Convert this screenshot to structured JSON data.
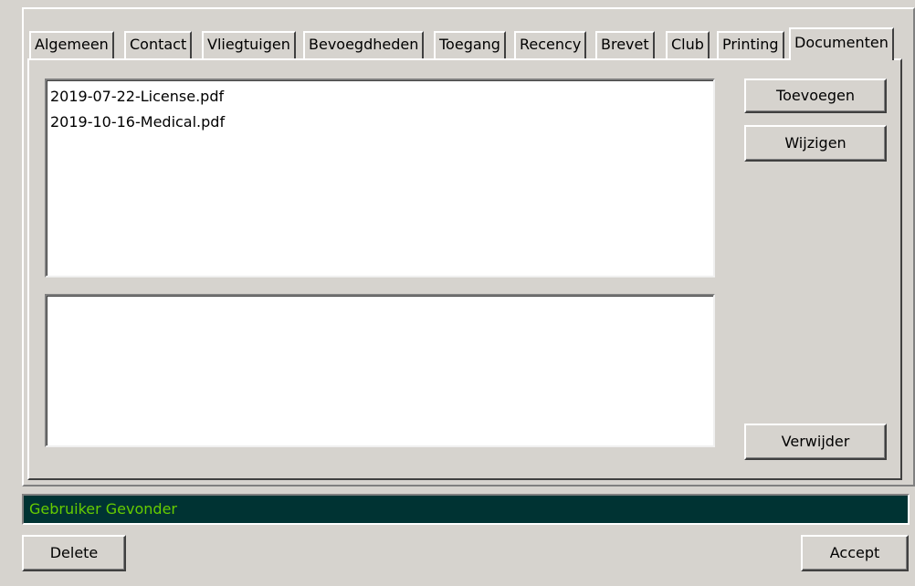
{
  "tabs": [
    {
      "label": "Algemeen",
      "active": false
    },
    {
      "label": "Contact",
      "active": false
    },
    {
      "label": "Vliegtuigen",
      "active": false
    },
    {
      "label": "Bevoegdheden",
      "active": false
    },
    {
      "label": "Toegang",
      "active": false
    },
    {
      "label": "Recency",
      "active": false
    },
    {
      "label": "Brevet",
      "active": false
    },
    {
      "label": "Club",
      "active": false
    },
    {
      "label": "Printing",
      "active": false
    },
    {
      "label": "Documenten",
      "active": true
    }
  ],
  "documents": {
    "files": [
      "2019-07-22-License.pdf",
      "2019-10-16-Medical.pdf"
    ],
    "add_label": "Toevoegen",
    "edit_label": "Wijzigen",
    "remove_label": "Verwijder"
  },
  "status": {
    "text": "Gebruiker Gevonder",
    "text_color": "#66cc00",
    "background": "#003333"
  },
  "footer": {
    "delete_label": "Delete",
    "accept_label": "Accept"
  }
}
